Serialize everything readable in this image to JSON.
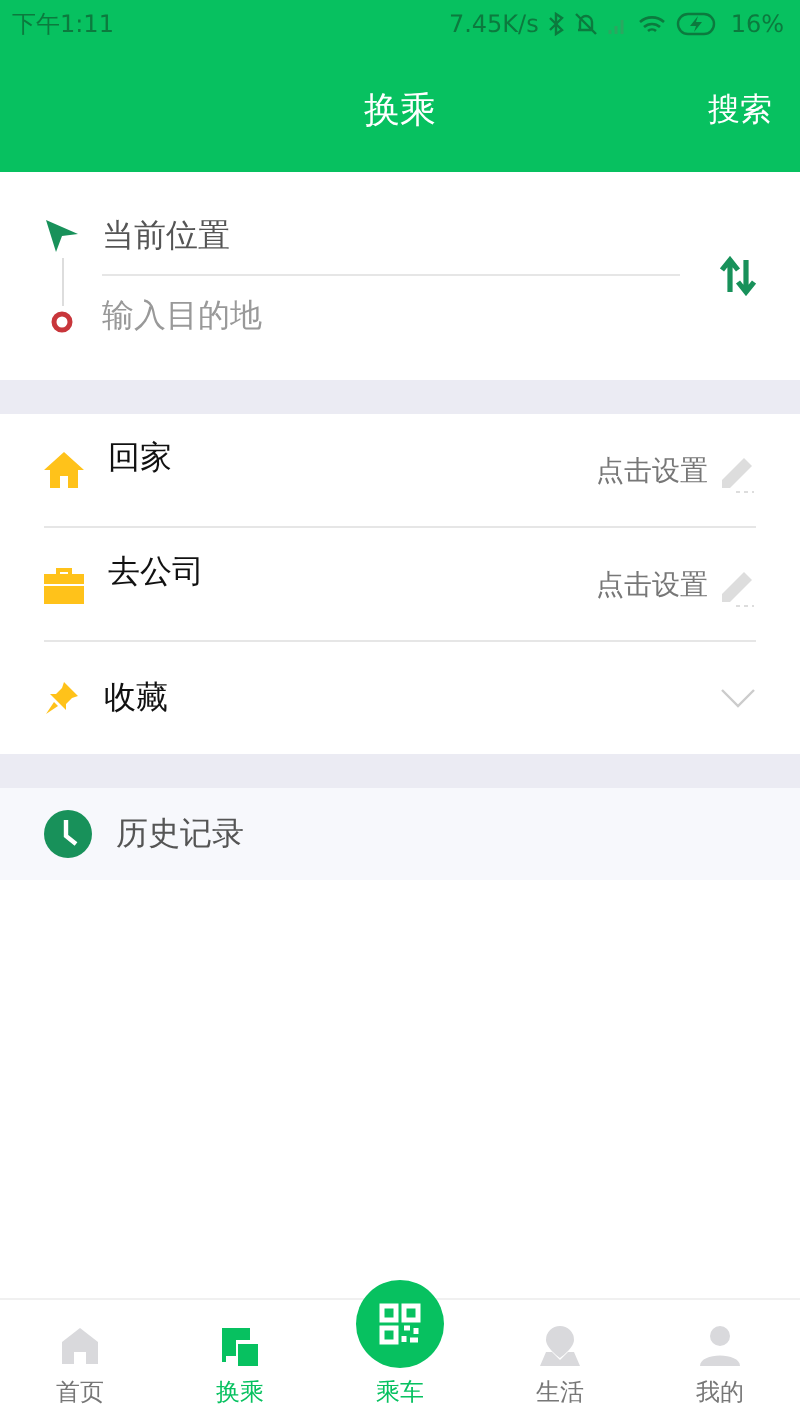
{
  "status_bar": {
    "time": "下午1:11",
    "speed": "7.45K/s",
    "battery": "16%"
  },
  "header": {
    "title": "换乘",
    "action": "搜索"
  },
  "route": {
    "origin": "当前位置",
    "destination_placeholder": "输入目的地"
  },
  "places": [
    {
      "kind": "home",
      "label": "回家",
      "hint": "点击设置"
    },
    {
      "kind": "work",
      "label": "去公司",
      "hint": "点击设置"
    },
    {
      "kind": "favorites",
      "label": "收藏",
      "expanded": false
    }
  ],
  "history": {
    "label": "历史记录"
  },
  "tabs": [
    {
      "kind": "home",
      "label": "首页",
      "selected": false
    },
    {
      "kind": "transfer",
      "label": "换乘",
      "selected": true
    },
    {
      "kind": "life",
      "label": "生活",
      "selected": false
    },
    {
      "kind": "me",
      "label": "我的",
      "selected": false
    }
  ],
  "ride_button": {
    "label": "乘车"
  }
}
